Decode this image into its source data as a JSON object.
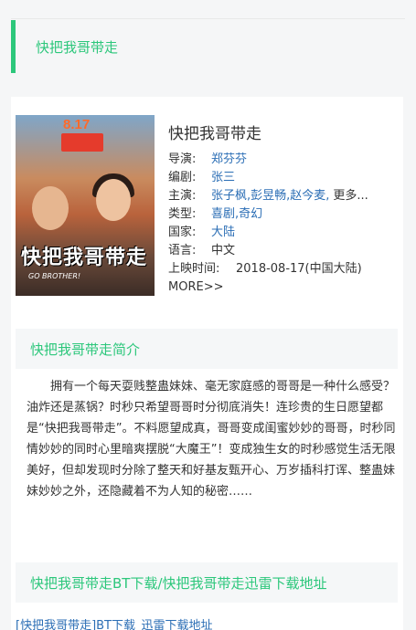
{
  "page_header": {
    "title": "快把我哥带走"
  },
  "movie": {
    "title": "快把我哥带走",
    "poster": {
      "date_text": "8.17",
      "title_text": "快把我哥带走",
      "subtitle_text": "GO BROTHER!"
    },
    "fields": {
      "director": {
        "label": "导演:",
        "value": "郑芬芬"
      },
      "writer": {
        "label": "编剧:",
        "value": "张三"
      },
      "cast": {
        "label": "主演:",
        "value": "张子枫,彭昱畅,赵今麦,",
        "more": "更多..."
      },
      "genre": {
        "label": "类型:",
        "value": "喜剧,奇幻"
      },
      "country": {
        "label": "国家:",
        "value": "大陆"
      },
      "language": {
        "label": "语言:",
        "value": "中文"
      },
      "release": {
        "label": "上映时间:",
        "value": "2018-08-17(中国大陆)"
      }
    },
    "more_label": "MORE>>"
  },
  "synopsis_section": {
    "title": "快把我哥带走简介",
    "text": "拥有一个每天耍贱整蛊妹妹、毫无家庭感的哥哥是一种什么感受？油炸还是蒸锅？时秒只希望哥哥时分彻底消失！连珍贵的生日愿望都是“快把我哥带走”。不料愿望成真，哥哥变成闺蜜妙妙的哥哥，时秒同情妙妙的同时心里暗爽摆脱“大魔王”！变成独生女的时秒感觉生活无限美好，但却发现时分除了整天和好基友甄开心、万岁插科打诨、整蛊妹妹妙妙之外，还隐藏着不为人知的秘密……"
  },
  "download_section": {
    "title": "快把我哥带走BT下载/快把我哥带走迅雷下载地址",
    "link_text": "[快把我哥带走]BT下载_迅雷下载地址"
  },
  "colors": {
    "accent": "#2cc77b",
    "link": "#2b6eb5"
  }
}
